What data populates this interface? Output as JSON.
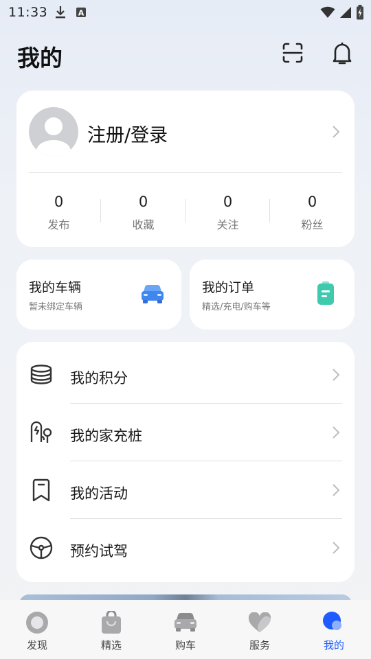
{
  "status_bar": {
    "time": "11:33",
    "left_icons": [
      "download-icon",
      "a-badge-icon"
    ],
    "right_icons": [
      "wifi-icon",
      "signal-icon",
      "battery-icon"
    ]
  },
  "header": {
    "title": "我的",
    "actions": [
      "scan-icon",
      "bell-icon"
    ]
  },
  "profile": {
    "login_label": "注册/登录",
    "stats": [
      {
        "value": "0",
        "label": "发布"
      },
      {
        "value": "0",
        "label": "收藏"
      },
      {
        "value": "0",
        "label": "关注"
      },
      {
        "value": "0",
        "label": "粉丝"
      }
    ]
  },
  "quick_cards": {
    "vehicle": {
      "title": "我的车辆",
      "subtitle": "暂未绑定车辆",
      "icon": "car-icon",
      "color": "#3f86f0"
    },
    "orders": {
      "title": "我的订单",
      "subtitle": "精选/充电/购车等",
      "icon": "order-icon",
      "color": "#3fc9ad"
    }
  },
  "menu": {
    "items": [
      {
        "label": "我的积分",
        "icon": "coins-stack-icon"
      },
      {
        "label": "我的家充桩",
        "icon": "home-charger-icon"
      },
      {
        "label": "我的活动",
        "icon": "bookmark-icon"
      },
      {
        "label": "预约试驾",
        "icon": "steering-wheel-icon"
      }
    ]
  },
  "tabbar": {
    "active_color": "#1f5cff",
    "tabs": [
      {
        "label": "发现",
        "icon": "discover-icon",
        "active": false
      },
      {
        "label": "精选",
        "icon": "shopping-bag-icon",
        "active": false
      },
      {
        "label": "购车",
        "icon": "car-front-icon",
        "active": false
      },
      {
        "label": "服务",
        "icon": "heart-icon",
        "active": false
      },
      {
        "label": "我的",
        "icon": "profile-dot-icon",
        "active": true
      }
    ]
  }
}
